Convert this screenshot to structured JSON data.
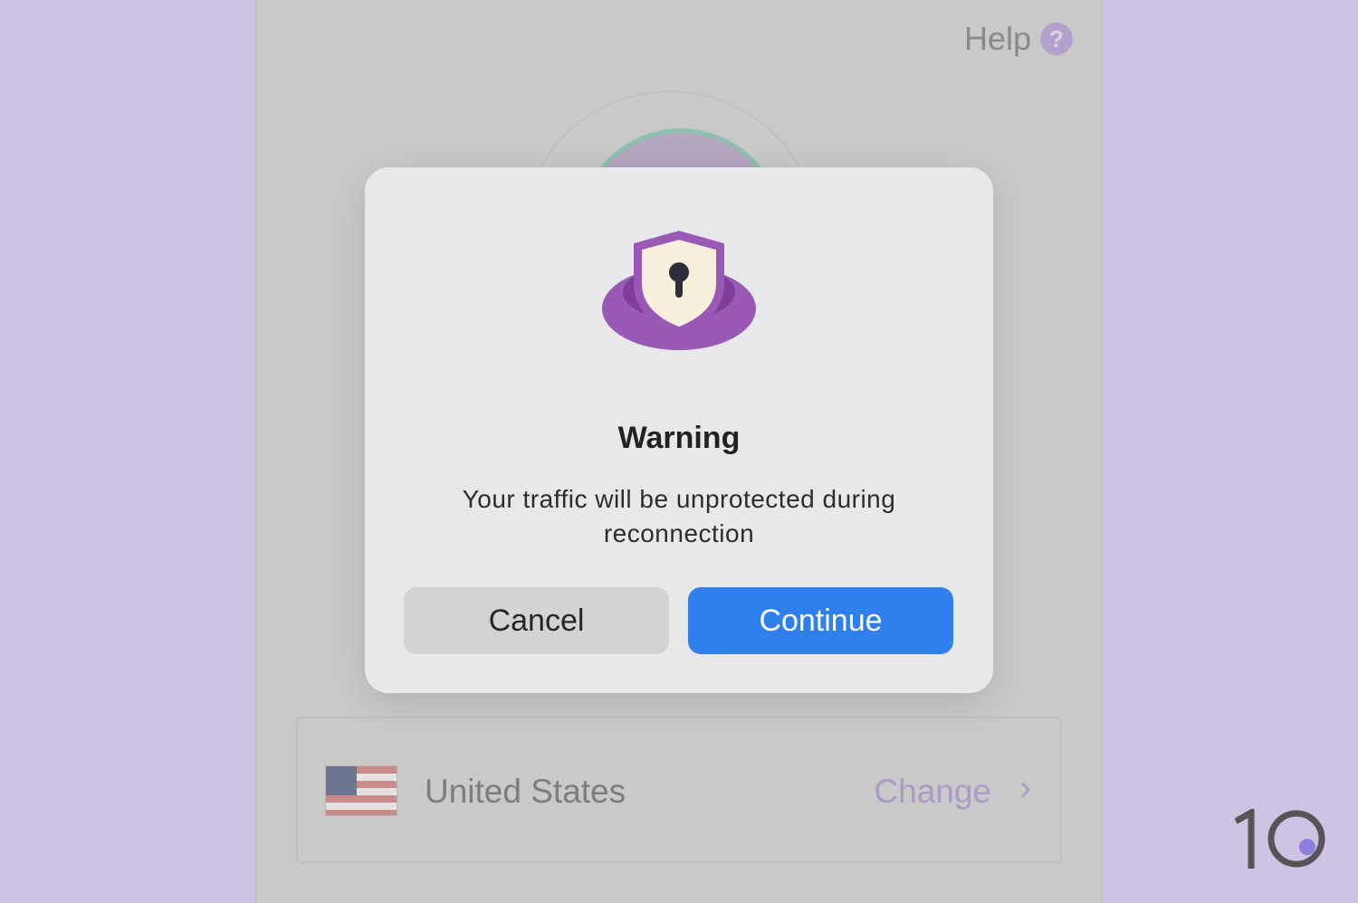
{
  "app": {
    "help_label": "Help",
    "help_icon_glyph": "?"
  },
  "location": {
    "flag_icon": "us-flag",
    "country": "United States",
    "change_label": "Change",
    "chevron_glyph": "›"
  },
  "dialog": {
    "icon": "shield-lock-icon",
    "title": "Warning",
    "message": "Your traffic will be unprotected during reconnection",
    "cancel_label": "Cancel",
    "continue_label": "Continue"
  },
  "watermark": {
    "text": "10"
  },
  "colors": {
    "page_background": "#cfc3e3",
    "accent_purple": "#9b59b6",
    "continue_blue": "#2f80ed"
  }
}
